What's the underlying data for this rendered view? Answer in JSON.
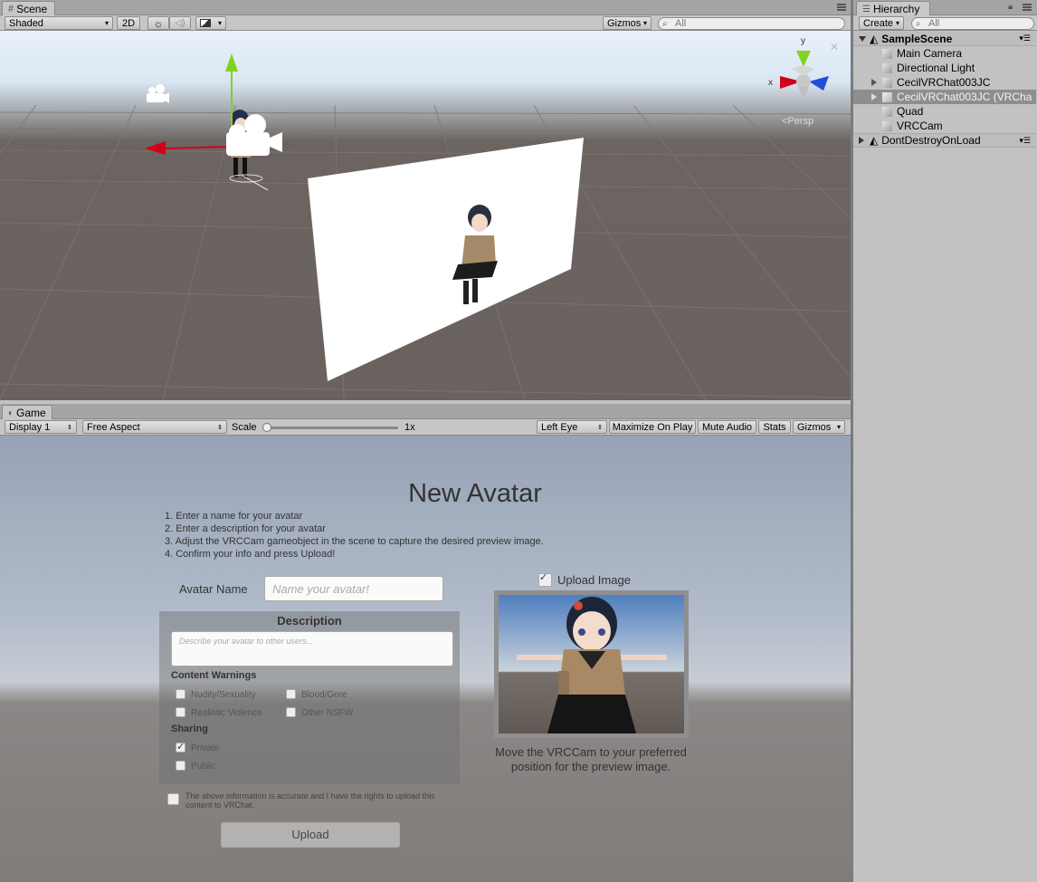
{
  "scene_panel": {
    "tab_label": "Scene",
    "shading_mode": "Shaded",
    "mode_2d": "2D",
    "gizmos_label": "Gizmos",
    "search_placeholder": "All",
    "persp_label": "Persp",
    "axis_y": "y",
    "axis_x": "x"
  },
  "hierarchy": {
    "tab_label": "Hierarchy",
    "create_label": "Create",
    "search_placeholder": "All",
    "items": [
      {
        "label": "SampleScene",
        "level": 0,
        "kind": "scene",
        "expanded": true
      },
      {
        "label": "Main Camera",
        "level": 1,
        "kind": "object"
      },
      {
        "label": "Directional Light",
        "level": 1,
        "kind": "object"
      },
      {
        "label": "CecilVRChat003JC",
        "level": 1,
        "kind": "object",
        "collapsed": true
      },
      {
        "label": "CecilVRChat003JC (VRCha",
        "level": 1,
        "kind": "object",
        "collapsed": true,
        "selected": true
      },
      {
        "label": "Quad",
        "level": 1,
        "kind": "object"
      },
      {
        "label": "VRCCam",
        "level": 1,
        "kind": "object"
      },
      {
        "label": "DontDestroyOnLoad",
        "level": 0,
        "kind": "scene",
        "collapsed": true
      }
    ]
  },
  "game_panel": {
    "tab_label": "Game",
    "display": "Display 1",
    "aspect": "Free Aspect",
    "scale_label": "Scale",
    "scale_value": "1x",
    "eye": "Left Eye",
    "maximize_label": "Maximize On Play",
    "mute_label": "Mute Audio",
    "stats_label": "Stats",
    "gizmos_label": "Gizmos"
  },
  "avatar_form": {
    "title": "New Avatar",
    "steps": [
      "1. Enter a name for your avatar",
      "2. Enter a description for your avatar",
      "3. Adjust the VRCCam gameobject in the scene to capture the desired preview image.",
      "4. Confirm your info and press Upload!"
    ],
    "name_label": "Avatar Name",
    "name_placeholder": "Name your avatar!",
    "description_header": "Description",
    "description_placeholder": "Describe your avatar to other users...",
    "content_warnings_header": "Content Warnings",
    "warnings": [
      {
        "label": "Nudity/Sexuality",
        "checked": false
      },
      {
        "label": "Blood/Gore",
        "checked": false
      },
      {
        "label": "Realistic Violence",
        "checked": false
      },
      {
        "label": "Other NSFW",
        "checked": false
      }
    ],
    "sharing_header": "Sharing",
    "sharing": [
      {
        "label": "Private",
        "checked": true
      },
      {
        "label": "Public",
        "checked": false
      }
    ],
    "legal_text": "The above information is accurate and I have the rights to upload this content to VRChat.",
    "upload_label": "Upload",
    "upload_image_label": "Upload Image",
    "preview_caption": "Move the VRCCam to your preferred position for the preview image."
  },
  "colors": {
    "gizmo_y": "#7ed321",
    "gizmo_x": "#d0021b",
    "gizmo_z": "#1d4fd8"
  }
}
